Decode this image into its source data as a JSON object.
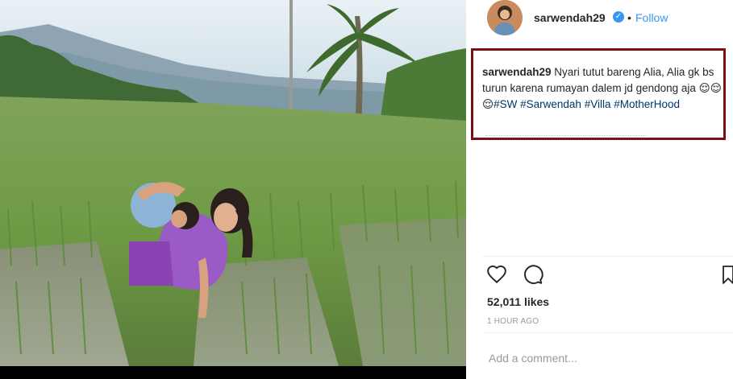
{
  "post": {
    "username": "sarwendah29",
    "follow_label": "Follow",
    "separator": "•",
    "caption": {
      "user": "sarwendah29",
      "text": " Nyari tutut bareng Alia, Alia gk bs turun karena rumayan dalem jd gendong aja 😌😌😌",
      "tags": [
        "#SW",
        "#Sarwendah",
        "#Villa",
        "#MotherHood"
      ]
    },
    "likes": "52,011 likes",
    "time": "1 HOUR AGO",
    "comment_placeholder": "Add a comment...",
    "more_label": "⋮"
  },
  "colors": {
    "accent": "#3897f0",
    "highlight_box": "#7b1015",
    "hashtag": "#003569"
  },
  "icons": [
    "verified-badge-icon",
    "heart-icon",
    "comment-icon",
    "bookmark-icon"
  ]
}
